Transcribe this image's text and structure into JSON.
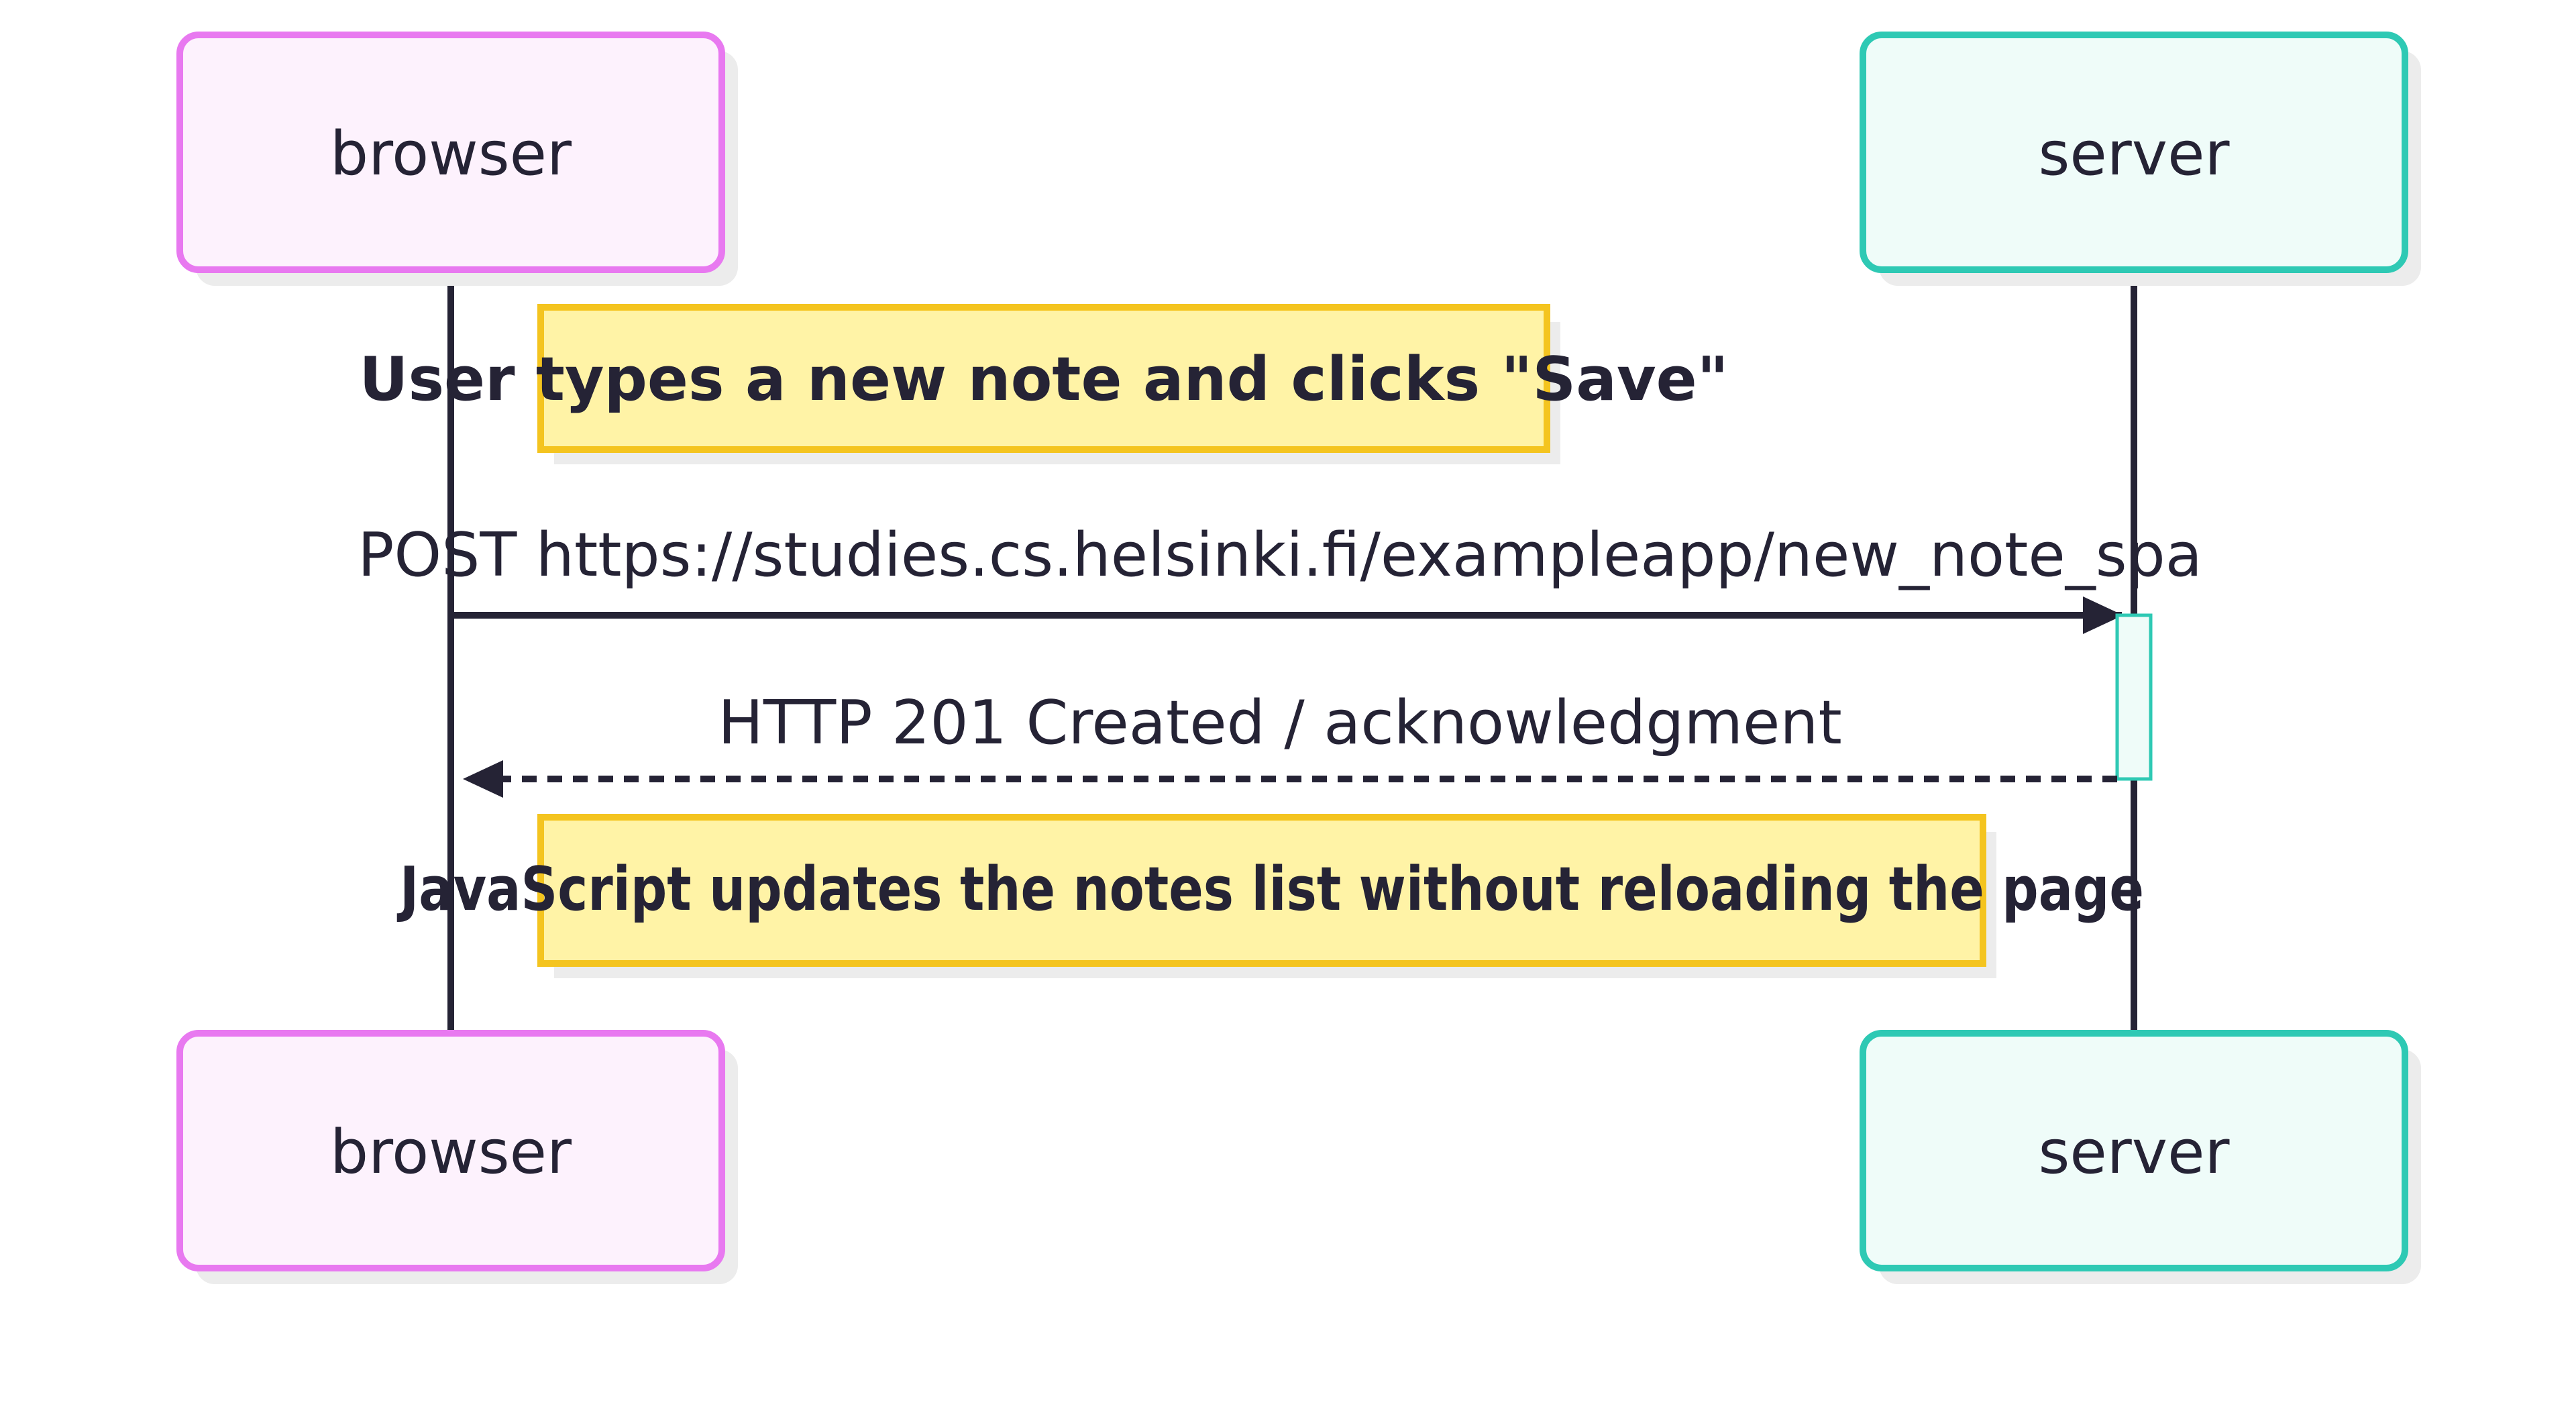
{
  "actors": {
    "browser": {
      "label": "browser",
      "stroke": "#e879f0",
      "fill": "#fdf2fd"
    },
    "server": {
      "label": "server",
      "stroke": "#2ec9b4",
      "fill": "#effcf9"
    }
  },
  "notes": [
    {
      "text": "User types a new note and clicks \"Save\""
    },
    {
      "text": "JavaScript updates the notes list without reloading the page"
    }
  ],
  "messages": [
    {
      "from": "browser",
      "to": "server",
      "text": "POST https://studies.cs.helsinki.fi/exampleapp/new_note_spa",
      "style": "solid"
    },
    {
      "from": "server",
      "to": "browser",
      "text": "HTTP 201 Created / acknowledgment",
      "style": "dashed"
    }
  ],
  "colors": {
    "line": "#252335",
    "note_fill": "#fff3a6",
    "note_stroke": "#f4c41f",
    "shadow": "#ececec",
    "activation_fill": "#effcf9",
    "activation_stroke": "#2ec9b4"
  }
}
